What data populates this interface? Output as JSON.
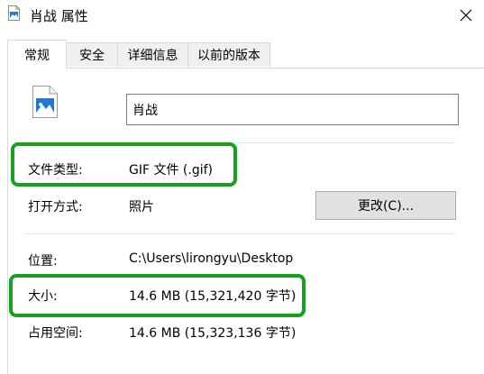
{
  "window": {
    "title": "肖战 属性",
    "close_label": "✕"
  },
  "tabs": [
    {
      "label": "常规",
      "active": true
    },
    {
      "label": "安全",
      "active": false
    },
    {
      "label": "详细信息",
      "active": false
    },
    {
      "label": "以前的版本",
      "active": false
    }
  ],
  "general": {
    "file_icon": "image-file-icon",
    "name_value": "肖战",
    "rows": {
      "type": {
        "label": "文件类型:",
        "value": "GIF 文件 (.gif)"
      },
      "opens": {
        "label": "打开方式:",
        "value": "照片",
        "button_label": "更改(C)..."
      },
      "location": {
        "label": "位置:",
        "value": "C:\\Users\\lirongyu\\Desktop"
      },
      "size": {
        "label": "大小:",
        "value": "14.6 MB (15,321,420 字节)"
      },
      "disk_size": {
        "label": "占用空间:",
        "value": "14.6 MB (15,323,136 字节)"
      }
    }
  },
  "colors": {
    "highlight": "#16a21c",
    "accent": "#1e78d7"
  }
}
